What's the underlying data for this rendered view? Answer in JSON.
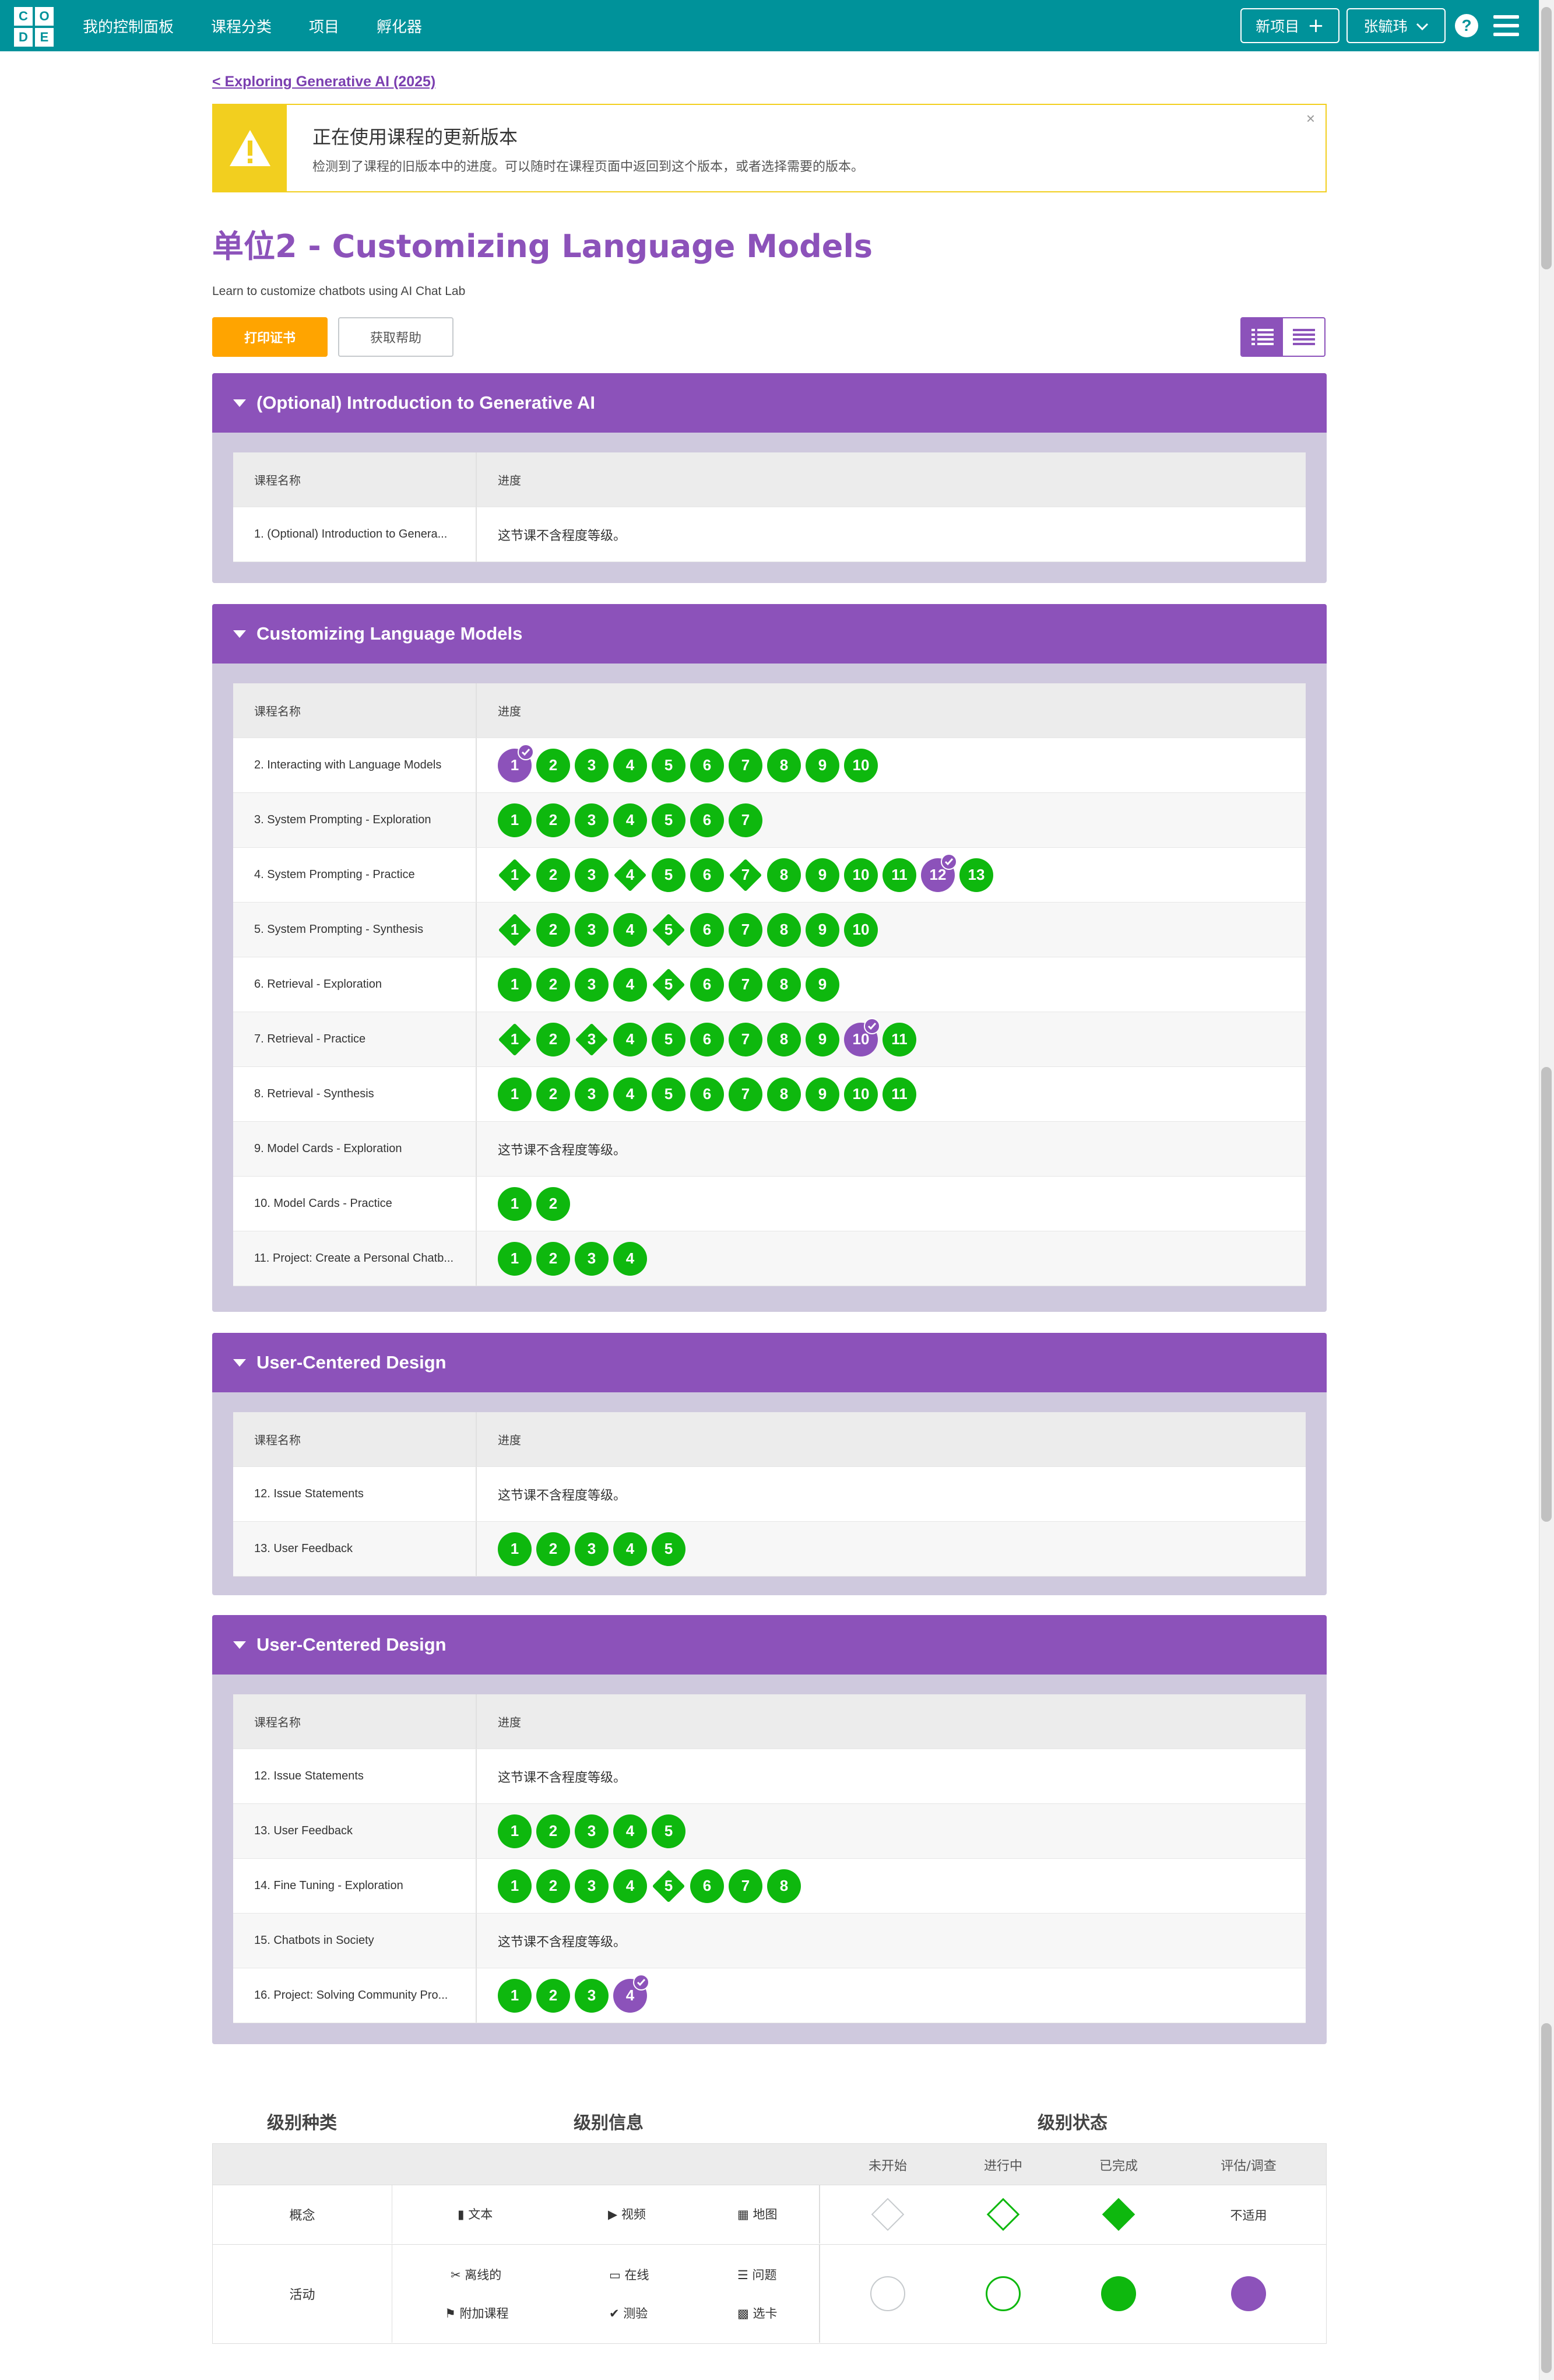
{
  "topbar": {
    "logo": [
      "C",
      "O",
      "D",
      "E"
    ],
    "nav": [
      "我的控制面板",
      "课程分类",
      "项目",
      "孵化器"
    ],
    "new_project": "新项目",
    "user": "张毓玮",
    "help": "?"
  },
  "back_link": "< Exploring Generative AI (2025)",
  "notice": {
    "title": "正在使用课程的更新版本",
    "body": "检测到了课程的旧版本中的进度。可以随时在课程页面中返回到这个版本，或者选择需要的版本。",
    "close": "×"
  },
  "unit_title": "单位2 - Customizing Language Models",
  "unit_description": "Learn to customize chatbots using AI Chat Lab",
  "buttons": {
    "print": "打印证书",
    "help": "获取帮助"
  },
  "table_headers": {
    "lesson": "课程名称",
    "progress": "进度"
  },
  "no_levels_text": "这节课不含程度等级。",
  "sections": [
    {
      "title": "(Optional) Introduction to Generative AI",
      "rows": [
        {
          "name": "1. (Optional) Introduction to Genera...",
          "levels": []
        }
      ]
    },
    {
      "title": "Customizing Language Models",
      "rows": [
        {
          "name": "2. Interacting with Language Models",
          "levels": [
            "1p✓",
            "2",
            "3",
            "4",
            "5",
            "6",
            "7",
            "8",
            "9",
            "10"
          ]
        },
        {
          "name": "3. System Prompting - Exploration",
          "levels": [
            "1",
            "2",
            "3",
            "4",
            "5",
            "6",
            "7"
          ]
        },
        {
          "name": "4. System Prompting - Practice",
          "levels": [
            "1d",
            "2",
            "3",
            "4d",
            "5",
            "6",
            "7d",
            "8",
            "9",
            "10",
            "11",
            "12p✓",
            "13"
          ]
        },
        {
          "name": "5. System Prompting - Synthesis",
          "levels": [
            "1d",
            "2",
            "3",
            "4",
            "5d",
            "6",
            "7",
            "8",
            "9",
            "10"
          ]
        },
        {
          "name": "6. Retrieval - Exploration",
          "levels": [
            "1",
            "2",
            "3",
            "4",
            "5d",
            "6",
            "7",
            "8",
            "9"
          ]
        },
        {
          "name": "7. Retrieval - Practice",
          "levels": [
            "1d",
            "2",
            "3d",
            "4",
            "5",
            "6",
            "7",
            "8",
            "9",
            "10p✓",
            "11"
          ]
        },
        {
          "name": "8. Retrieval - Synthesis",
          "levels": [
            "1",
            "2",
            "3",
            "4",
            "5",
            "6",
            "7",
            "8",
            "9",
            "10",
            "11"
          ]
        },
        {
          "name": "9. Model Cards - Exploration",
          "levels": []
        },
        {
          "name": "10. Model Cards - Practice",
          "levels": [
            "1",
            "2"
          ]
        },
        {
          "name": "11. Project: Create a Personal Chatb...",
          "levels": [
            "1",
            "2",
            "3",
            "4"
          ]
        }
      ]
    },
    {
      "title": "User-Centered Design",
      "rows": [
        {
          "name": "12. Issue Statements",
          "levels": []
        },
        {
          "name": "13. User Feedback",
          "levels": [
            "1",
            "2",
            "3",
            "4",
            "5"
          ]
        }
      ]
    },
    {
      "title": "User-Centered Design",
      "rows": [
        {
          "name": "12. Issue Statements",
          "levels": []
        },
        {
          "name": "13. User Feedback",
          "levels": [
            "1",
            "2",
            "3",
            "4",
            "5"
          ]
        },
        {
          "name": "14. Fine Tuning - Exploration",
          "levels": [
            "1",
            "2",
            "3",
            "4",
            "5d",
            "6",
            "7",
            "8"
          ]
        },
        {
          "name": "15. Chatbots in Society",
          "levels": []
        },
        {
          "name": "16. Project: Solving Community Pro...",
          "levels": [
            "1",
            "2",
            "3",
            "4p✓"
          ]
        }
      ]
    }
  ],
  "key": {
    "headings": {
      "types": "级别种类",
      "info": "级别信息",
      "status": "级别状态"
    },
    "status_cols": [
      "未开始",
      "进行中",
      "已完成",
      "评估/调查"
    ],
    "concept": {
      "label": "概念",
      "items": [
        "文本",
        "视频",
        "地图"
      ],
      "na": "不适用"
    },
    "activity": {
      "label": "活动",
      "items": [
        "离线的",
        "在线",
        "问题",
        "附加课程",
        "测验",
        "选卡"
      ]
    }
  },
  "colors": {
    "teal": "#00929a",
    "purple": "#8c52ba",
    "green": "#0eb80e",
    "orange": "#ffa400",
    "yellow": "#f2cf1f"
  }
}
